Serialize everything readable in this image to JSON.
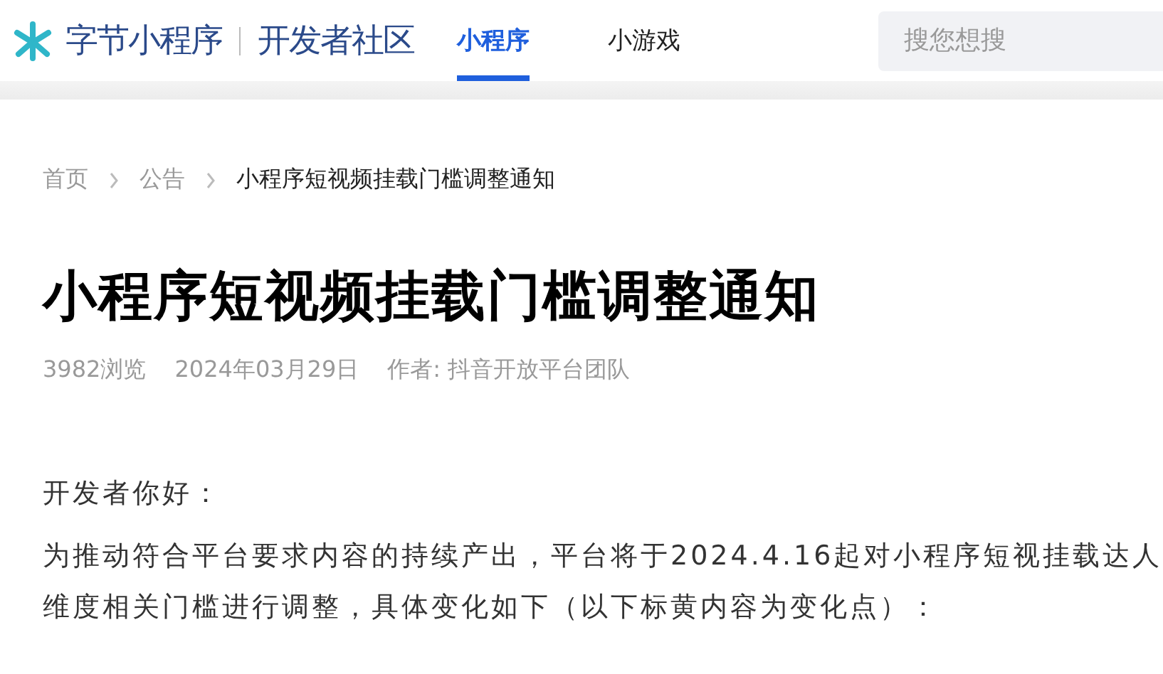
{
  "header": {
    "logo": "字节小程序",
    "community": "开发者社区",
    "nav": [
      {
        "label": "小程序",
        "selected": true
      },
      {
        "label": "小游戏",
        "selected": false
      }
    ],
    "search": {
      "placeholder": "搜您想搜"
    }
  },
  "breadcrumb": [
    "首页",
    "公告",
    "小程序短视频挂载门槛调整通知"
  ],
  "article": {
    "title": "小程序短视频挂载门槛调整通知",
    "views": "3982浏览",
    "date": "2024年03月29日",
    "author": "作者: 抖音开放平台团队",
    "paragraphs": [
      "开发者你好：",
      "为推动符合平台要求内容的持续产出，平台将于2024.4.16起对小程序短视挂载达人维度相关门槛进行调整，具体变化如下（以下标黄内容为变化点）："
    ]
  }
}
